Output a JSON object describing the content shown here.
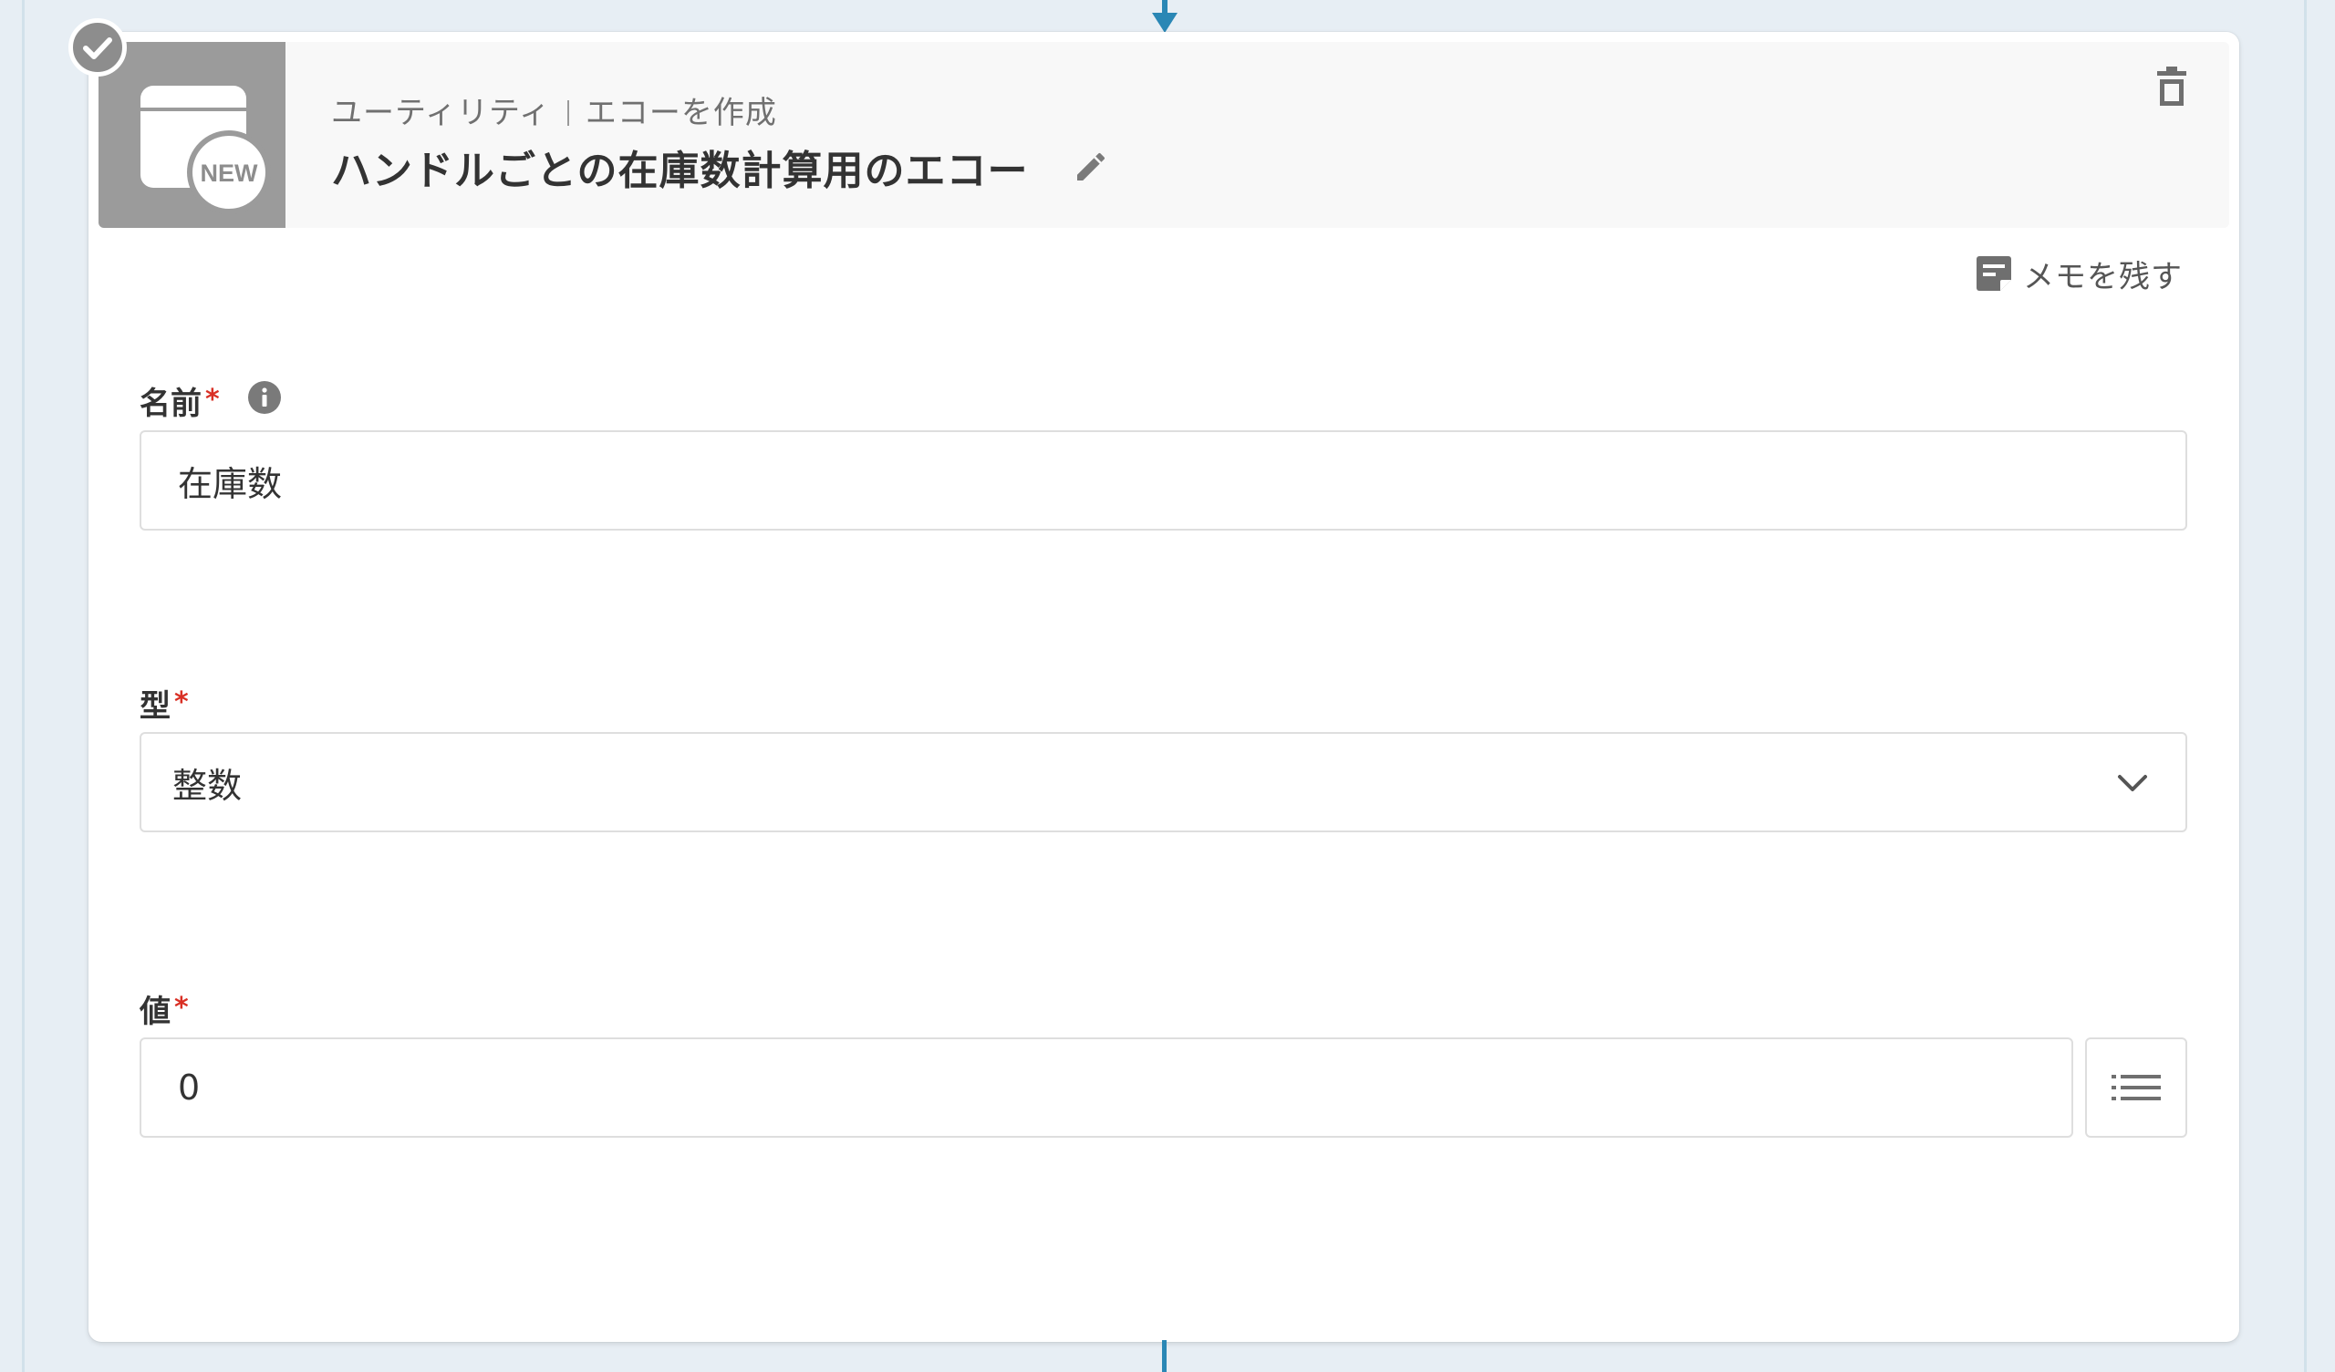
{
  "step": {
    "breadcrumb_category": "ユーティリティ",
    "breadcrumb_action": "エコーを作成",
    "title": "ハンドルごとの在庫数計算用のエコー",
    "status": "completed",
    "app_icon": "new-app-icon",
    "app_icon_badge": "NEW"
  },
  "header_actions": {
    "delete_icon": "trash-icon",
    "edit_icon": "pencil-icon"
  },
  "memo": {
    "label": "メモを残す",
    "icon": "memo-icon"
  },
  "form": {
    "name": {
      "label": "名前",
      "required_mark": "*",
      "value": "在庫数",
      "info_icon": "info-icon"
    },
    "type": {
      "label": "型",
      "required_mark": "*",
      "selected": "整数",
      "dropdown_icon": "chevron-down-icon"
    },
    "value": {
      "label": "値",
      "required_mark": "*",
      "value": "0",
      "list_icon": "list-icon"
    }
  },
  "colors": {
    "flow_accent": "#2a87b5",
    "required": "#d93025",
    "icon_gray": "#9b9b9b",
    "card_bg": "#ffffff",
    "canvas_bg": "#e7eef4"
  }
}
